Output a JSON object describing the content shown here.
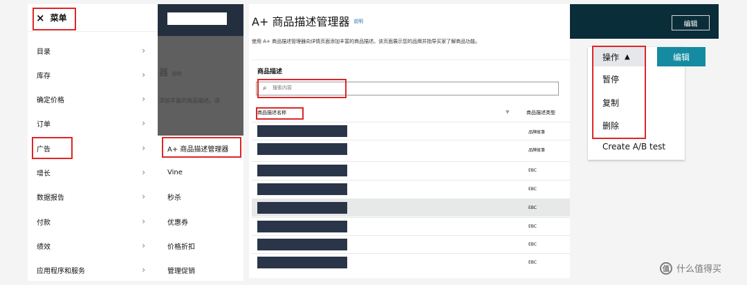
{
  "menu": {
    "close_glyph": "×",
    "title": "菜单",
    "items": [
      {
        "label": "目录"
      },
      {
        "label": "库存"
      },
      {
        "label": "确定价格"
      },
      {
        "label": "订单"
      },
      {
        "label": "广告"
      },
      {
        "label": "增长"
      },
      {
        "label": "数据报告"
      },
      {
        "label": "付款"
      },
      {
        "label": "绩效"
      },
      {
        "label": "应用程序和服务"
      }
    ]
  },
  "submenu": {
    "items": [
      {
        "label": "A+ 商品描述管理器"
      },
      {
        "label": "Vine"
      },
      {
        "label": "秒杀"
      },
      {
        "label": "优惠券"
      },
      {
        "label": "价格折扣"
      },
      {
        "label": "管理促销"
      }
    ],
    "faint_heading": "器",
    "faint_tag": "说明",
    "faint_text": "添加丰富的商品描述。该"
  },
  "manager": {
    "title": "A+ 商品描述管理器",
    "title_link": "说明",
    "description": "使用 A+ 商品描述管理器向详情页面添加丰富的商品描述。该页面展示您的品牌并指导买家了解商品功能。",
    "section_label": "商品描述",
    "search_placeholder": "搜索内容",
    "col_name": "商品描述名称",
    "col_type": "商品描述类型",
    "rows": [
      {
        "type": "品牌故事"
      },
      {
        "type": "品牌故事"
      },
      {
        "type": "EBC"
      },
      {
        "type": "EBC"
      },
      {
        "type": "EBC"
      },
      {
        "type": "EBC"
      },
      {
        "type": "EBC"
      },
      {
        "type": "EBC"
      }
    ]
  },
  "actions": {
    "top_edit": "编辑",
    "button": "操作",
    "items": [
      {
        "label": "暂停"
      },
      {
        "label": "复制"
      },
      {
        "label": "删除"
      },
      {
        "label": "Create A/B test"
      }
    ],
    "edit": "编辑"
  },
  "watermark": {
    "icon": "值",
    "text": "什么值得买"
  },
  "colors": {
    "highlight": "#e02424",
    "dark_nav": "#0a2d3a",
    "teal_button": "#148ba0"
  }
}
